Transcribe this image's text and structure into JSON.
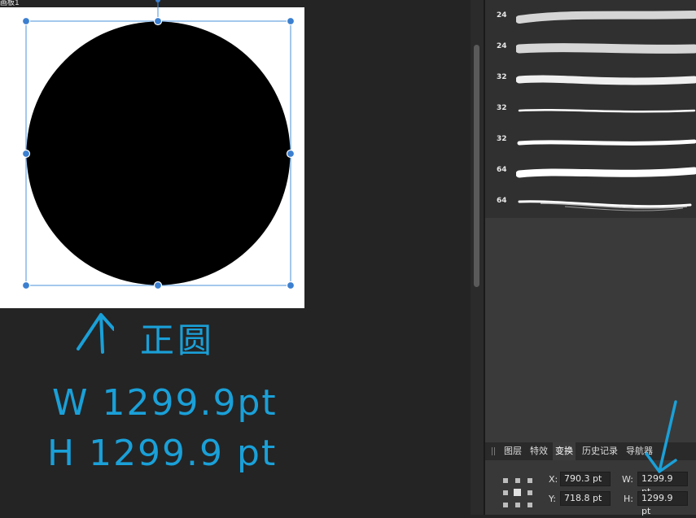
{
  "document": {
    "title": "画板1"
  },
  "annotation": {
    "label": "正圆",
    "w_line": "W 1299.9pt",
    "h_line": "H 1299.9 pt"
  },
  "brushes": [
    {
      "size": "24"
    },
    {
      "size": "24"
    },
    {
      "size": "32"
    },
    {
      "size": "32"
    },
    {
      "size": "32"
    },
    {
      "size": "64"
    },
    {
      "size": "64"
    }
  ],
  "tabs": [
    {
      "label": "图层",
      "active": false
    },
    {
      "label": "特效",
      "active": false
    },
    {
      "label": "变换",
      "active": true
    },
    {
      "label": "历史记录",
      "active": false
    },
    {
      "label": "导航器",
      "active": false
    }
  ],
  "transform": {
    "x_label": "X:",
    "x_value": "790.3 pt",
    "y_label": "Y:",
    "y_value": "718.8 pt",
    "w_label": "W:",
    "w_value": "1299.9 pt",
    "h_label": "H:",
    "h_value": "1299.9 pt"
  },
  "colors": {
    "annotation": "#1aa0d8",
    "selection": "#4a90d9",
    "shape_fill": "#000000"
  }
}
